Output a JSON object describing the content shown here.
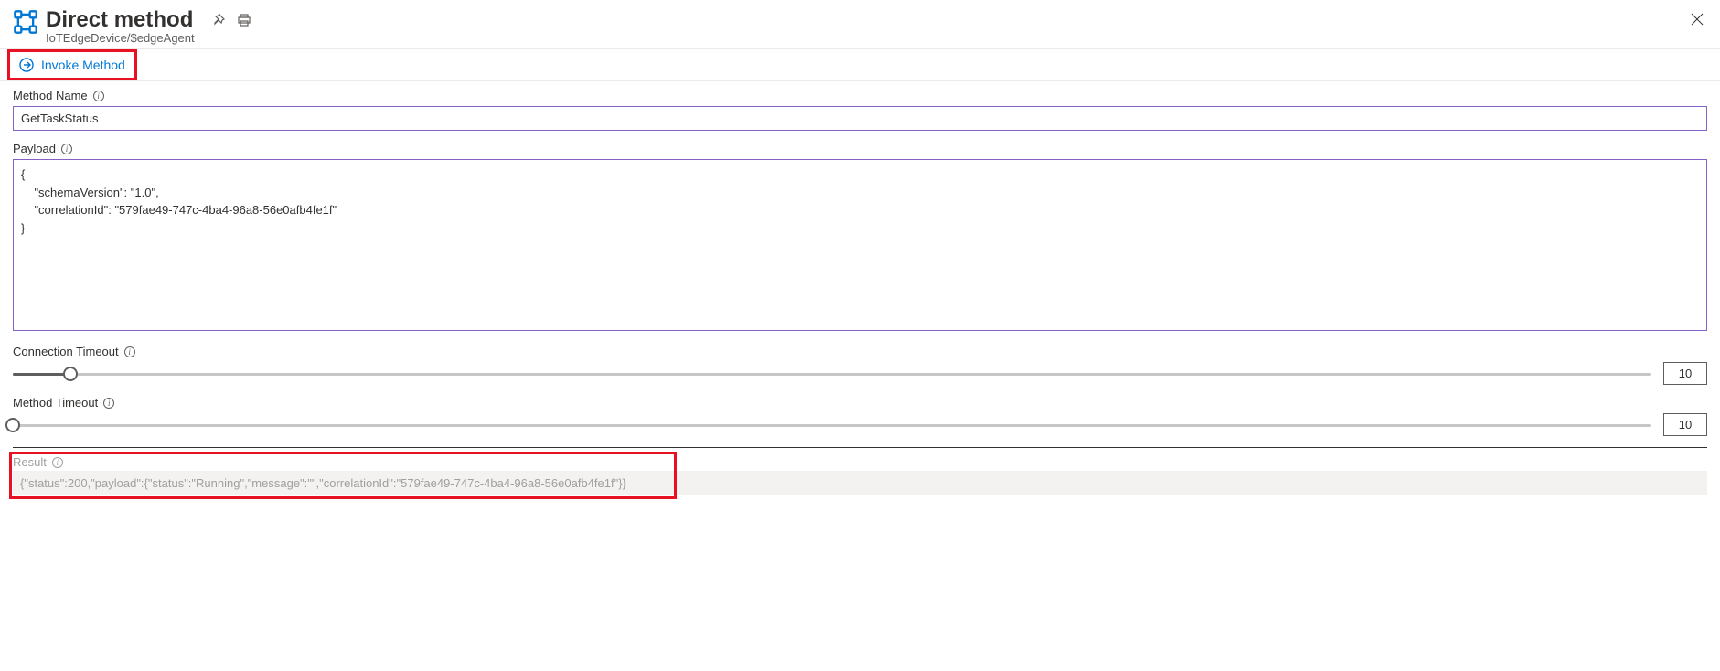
{
  "header": {
    "title": "Direct method",
    "subtitle": "IoTEdgeDevice/$edgeAgent"
  },
  "toolbar": {
    "invoke_label": "Invoke Method"
  },
  "fields": {
    "method_name": {
      "label": "Method Name",
      "value": "GetTaskStatus"
    },
    "payload": {
      "label": "Payload",
      "value": "{\n    \"schemaVersion\": \"1.0\",\n    \"correlationId\": \"579fae49-747c-4ba4-96a8-56e0afb4fe1f\"\n}"
    },
    "connection_timeout": {
      "label": "Connection Timeout",
      "value": "10",
      "percent": 3.5
    },
    "method_timeout": {
      "label": "Method Timeout",
      "value": "10",
      "percent": 0
    }
  },
  "result": {
    "label": "Result",
    "value": "{\"status\":200,\"payload\":{\"status\":\"Running\",\"message\":\"\",\"correlationId\":\"579fae49-747c-4ba4-96a8-56e0afb4fe1f\"}}"
  }
}
